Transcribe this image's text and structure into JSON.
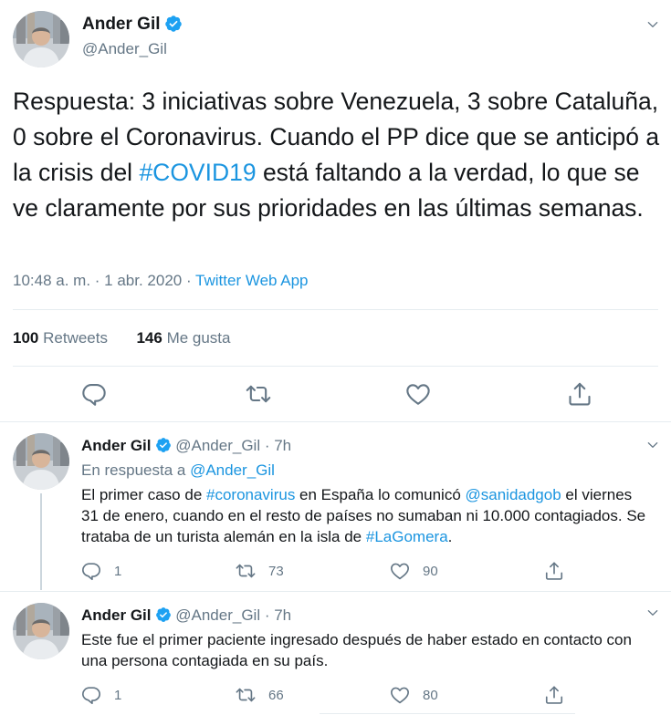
{
  "main_tweet": {
    "name": "Ander Gil",
    "handle": "@Ander_Gil",
    "text_before": "Respuesta: 3 iniciativas sobre Venezuela, 3 sobre Cataluña, 0 sobre el Coronavirus. Cuando el PP dice que se anticipó a la crisis del ",
    "hashtag": "#COVID19",
    "text_after": " está faltando a la verdad, lo que se ve claramente por sus prioridades en las últimas semanas.",
    "time": "10:48 a. m. · 1 abr. 2020 · ",
    "source": "Twitter Web App",
    "retweets_count": "100",
    "retweets_label": "Retweets",
    "likes_count": "146",
    "likes_label": "Me gusta"
  },
  "replies": [
    {
      "name": "Ander Gil",
      "handle": "@Ander_Gil",
      "time": "· 7h",
      "in_reply_label": "En respuesta a ",
      "in_reply_handle": "@Ander_Gil",
      "text_1": "El primer caso de ",
      "tag_1": "#coronavirus",
      "text_2": " en España lo comunicó ",
      "tag_2": "@sanidadgob",
      "text_3": " el viernes 31 de enero, cuando en el resto de países no sumaban ni 10.000 contagiados. Se trataba de un turista alemán en la isla de ",
      "tag_3": "#LaGomera",
      "text_4": ".",
      "replies": "1",
      "retweets": "73",
      "likes": "90"
    },
    {
      "name": "Ander Gil",
      "handle": "@Ander_Gil",
      "time": "· 7h",
      "text": "Este fue el primer paciente ingresado después de haber estado en contacto con una persona contagiada en su país.",
      "replies": "1",
      "retweets": "66",
      "likes": "80"
    }
  ],
  "colors": {
    "link": "#1b95e0",
    "secondary_text": "#657786",
    "divider": "#e6ecf0"
  }
}
